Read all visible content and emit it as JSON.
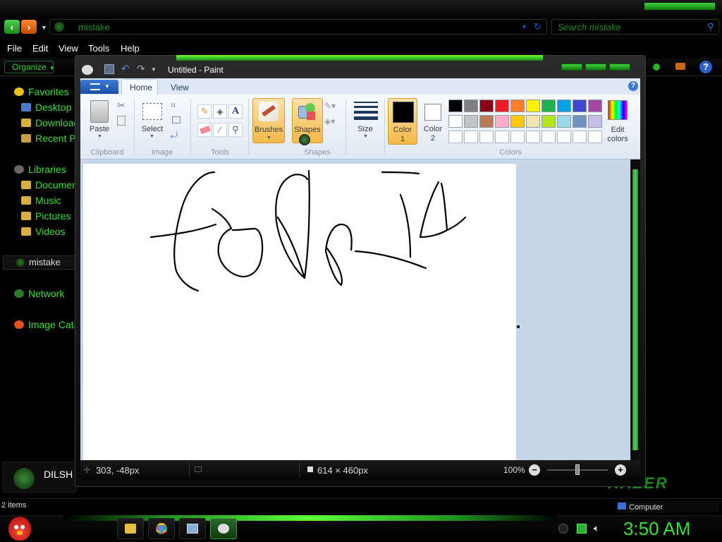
{
  "explorer": {
    "address": "mistake",
    "search_placeholder": "Search mistake",
    "menu": [
      "File",
      "Edit",
      "View",
      "Tools",
      "Help"
    ],
    "organize": "Organize",
    "favorites": {
      "header": "Favorites",
      "items": [
        "Desktop",
        "Downloads",
        "Recent P"
      ]
    },
    "libraries": {
      "header": "Libraries",
      "items": [
        "Documen",
        "Music",
        "Pictures",
        "Videos"
      ]
    },
    "current_folder": "mistake",
    "network": "Network",
    "image_catalog": "Image Cata",
    "user_name": "DILSH",
    "items_count": "2 items",
    "computer": "Computer",
    "brand": "RAZER"
  },
  "paint": {
    "title": "Untitled - Paint",
    "tabs": [
      "Home",
      "View"
    ],
    "groups": {
      "clipboard": "Clipboard",
      "image": "Image",
      "tools": "Tools",
      "shapes": "Shapes",
      "colors": "Colors"
    },
    "buttons": {
      "paste": "Paste",
      "select": "Select",
      "brushes": "Brushes",
      "shapes": "Shapes",
      "size": "Size",
      "color1_a": "Color",
      "color1_b": "1",
      "color2_a": "Color",
      "color2_b": "2",
      "edit_colors_a": "Edit",
      "edit_colors_b": "colors"
    },
    "palette_row1": [
      "#000000",
      "#7f7f7f",
      "#880015",
      "#ed1c24",
      "#ff7f27",
      "#fff200",
      "#22b14c",
      "#00a2e8",
      "#3f48cc",
      "#a349a4"
    ],
    "palette_row2": [
      "#ffffff",
      "#c3c3c3",
      "#b97a57",
      "#ffaec9",
      "#ffc90e",
      "#efe4b0",
      "#b5e61d",
      "#99d9ea",
      "#7092be",
      "#c8bfe7"
    ],
    "color1": "#000000",
    "color2": "#ffffff",
    "status": {
      "cursor_pos": "303, -48px",
      "canvas_size": "614 × 460px",
      "zoom": "100%"
    }
  },
  "taskbar": {
    "clock": "3:50 AM"
  }
}
